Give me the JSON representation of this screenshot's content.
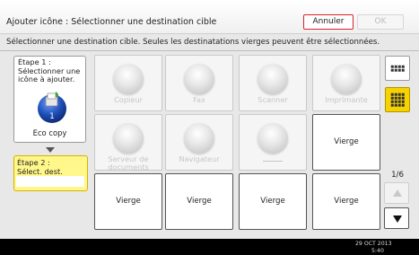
{
  "header": {
    "title": "Ajouter icône : Sélectionner une destination cible",
    "cancel_label": "Annuler",
    "ok_label": "OK"
  },
  "instruction": "Sélectionner une destination cible. Seules les destinatations vierges peuvent être sélectionnées.",
  "steps": [
    {
      "label_line1": "Étape 1 :",
      "label_line2": "Sélectionner une",
      "label_line3": "icône à ajouter.",
      "icon": "eco-copy-icon",
      "icon_number": "1",
      "caption": "Eco copy"
    },
    {
      "label_line1": "Étape 2 :",
      "label_line2": "Sélect. dest."
    }
  ],
  "grid": {
    "tiles": [
      {
        "label": "Copieur"
      },
      {
        "label": "Fax"
      },
      {
        "label": "Scanner"
      },
      {
        "label": "Imprimante"
      },
      {
        "label_line1": "Serveur de",
        "label_line2": "documents"
      },
      {
        "label": "Navigateur"
      },
      {
        "label": ""
      },
      {
        "label": "Vierge"
      },
      {
        "label": "Vierge"
      },
      {
        "label": "Vierge"
      },
      {
        "label": "Vierge"
      },
      {
        "label": "Vierge"
      }
    ]
  },
  "view_buttons": [
    {
      "icon": "grid-3x3-icon",
      "selected": false
    },
    {
      "icon": "grid-4x4-icon",
      "selected": true
    }
  ],
  "pagination": {
    "label": "1/6"
  },
  "status": {
    "date": "29 OCT  2013",
    "time": "5:40"
  },
  "colors": {
    "accent_yellow": "#f5d200",
    "cancel_border": "#d8232a",
    "icon_blue": "#1f4fb8"
  }
}
